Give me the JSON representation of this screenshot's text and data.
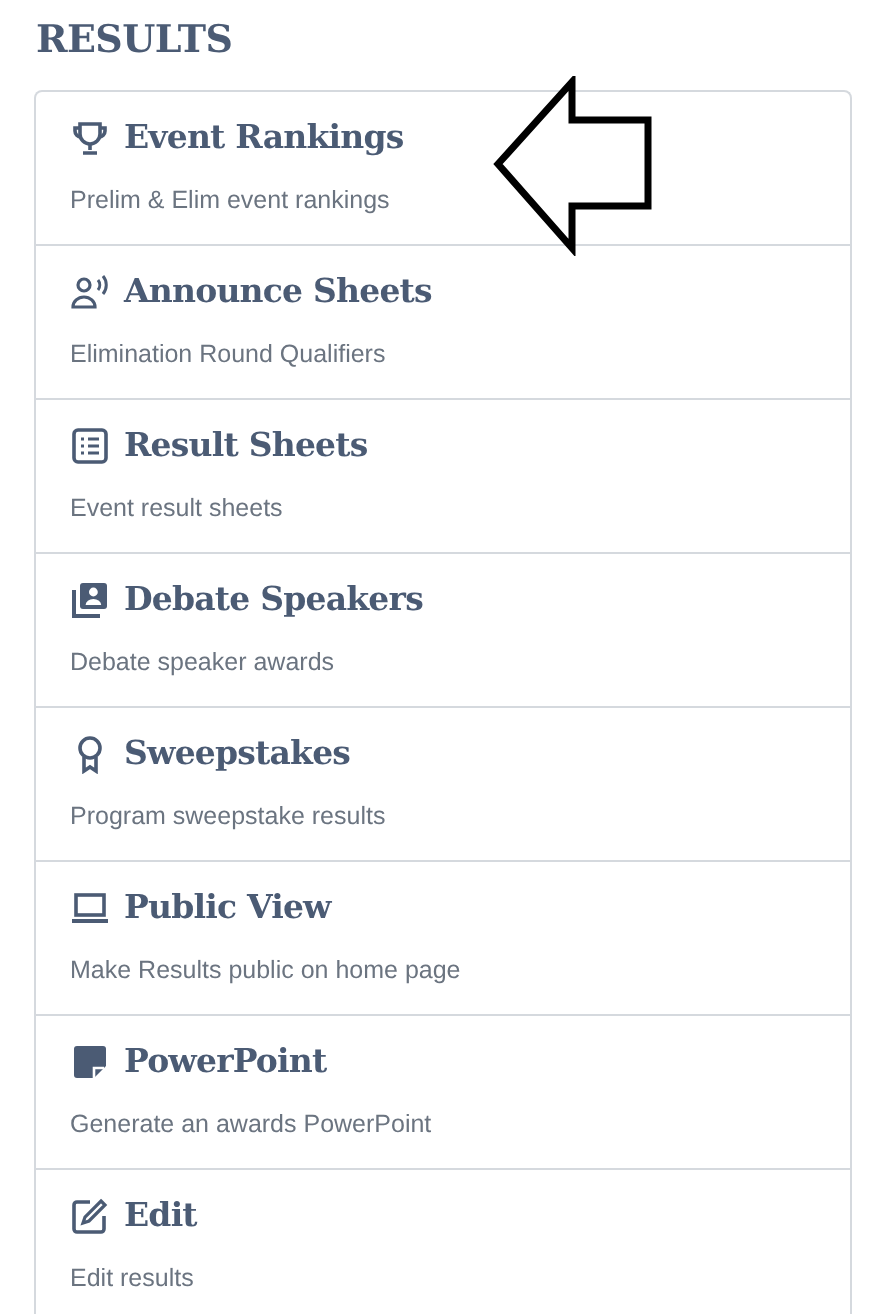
{
  "heading": "RESULTS",
  "items": [
    {
      "title": "Event Rankings",
      "description": "Prelim & Elim event rankings"
    },
    {
      "title": "Announce Sheets",
      "description": "Elimination Round Qualifiers"
    },
    {
      "title": "Result Sheets",
      "description": "Event result sheets"
    },
    {
      "title": "Debate Speakers",
      "description": "Debate speaker awards"
    },
    {
      "title": "Sweepstakes",
      "description": "Program sweepstake results"
    },
    {
      "title": "Public View",
      "description": "Make Results public on home page"
    },
    {
      "title": "PowerPoint",
      "description": "Generate an awards PowerPoint"
    },
    {
      "title": "Edit",
      "description": "Edit results"
    }
  ]
}
